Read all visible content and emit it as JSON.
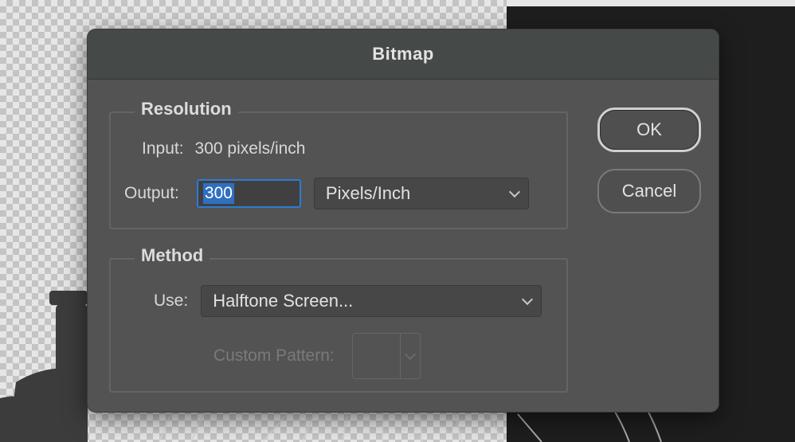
{
  "dialog": {
    "title": "Bitmap",
    "resolution": {
      "legend": "Resolution",
      "input_label": "Input:",
      "input_value": "300 pixels/inch",
      "output_label": "Output:",
      "output_value": "300",
      "unit_select": "Pixels/Inch"
    },
    "method": {
      "legend": "Method",
      "use_label": "Use:",
      "use_select": "Halftone Screen...",
      "custom_pattern_label": "Custom Pattern:"
    },
    "buttons": {
      "ok": "OK",
      "cancel": "Cancel"
    }
  },
  "icons": {
    "unit_chevron": "chevron-down-icon",
    "use_chevron": "chevron-down-icon",
    "pattern_chevron": "chevron-down-icon"
  },
  "colors": {
    "dialog_bg": "#535353",
    "titlebar_bg": "#454948",
    "focus_blue": "#2e7bd4",
    "selection_blue": "#2f6fc2"
  }
}
